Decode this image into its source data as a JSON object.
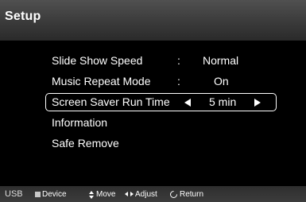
{
  "header": {
    "title": "Setup"
  },
  "menu": [
    {
      "label": "Slide Show Speed",
      "colon": ":",
      "value": "Normal"
    },
    {
      "label": "Music Repeat Mode",
      "colon": ":",
      "value": "On"
    },
    {
      "label": "Screen Saver Run Time",
      "value": "5 min",
      "selected": true
    },
    {
      "label": "Information"
    },
    {
      "label": "Safe Remove"
    }
  ],
  "footer": {
    "source": "USB",
    "device": "Device",
    "move": "Move",
    "adjust": "Adjust",
    "return": "Return"
  }
}
